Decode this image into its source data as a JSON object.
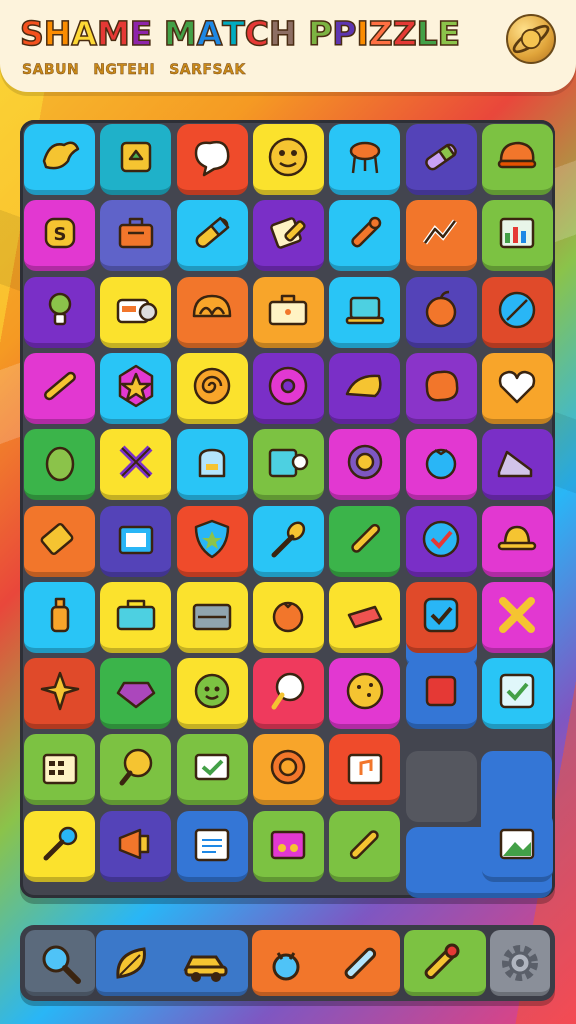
{
  "header": {
    "title_letters": [
      {
        "ch": "S",
        "color": "#f4511e"
      },
      {
        "ch": "H",
        "color": "#fb8c00"
      },
      {
        "ch": "A",
        "color": "#fdd835"
      },
      {
        "ch": "M",
        "color": "#e53935"
      },
      {
        "ch": "E",
        "color": "#8e24aa"
      },
      {
        "ch": " ",
        "color": "#000000"
      },
      {
        "ch": "M",
        "color": "#43a047"
      },
      {
        "ch": "A",
        "color": "#1e88e5"
      },
      {
        "ch": "T",
        "color": "#00acc1"
      },
      {
        "ch": "C",
        "color": "#e53935"
      },
      {
        "ch": "H",
        "color": "#8d6e63"
      },
      {
        "ch": " ",
        "color": "#000000"
      },
      {
        "ch": "P",
        "color": "#7cb342"
      },
      {
        "ch": "P",
        "color": "#5e35b1"
      },
      {
        "ch": "I",
        "color": "#fb8c00"
      },
      {
        "ch": "Z",
        "color": "#ff7043"
      },
      {
        "ch": "Z",
        "color": "#e53935"
      },
      {
        "ch": "L",
        "color": "#43a047"
      },
      {
        "ch": "E",
        "color": "#8bc34a"
      }
    ],
    "subtitle_parts": [
      "SABUN",
      "NGTEHI",
      "SARFSAK"
    ],
    "settings_icon": "planet-icon"
  },
  "board": {
    "rows": [
      [
        {
          "c": "#29c5f6",
          "i": "bird"
        },
        {
          "c": "#1fb1c9",
          "i": "cube"
        },
        {
          "c": "#ef4b2b",
          "i": "heart-bubble"
        },
        {
          "c": "#fbe22d",
          "i": "face"
        },
        {
          "c": "#29c5f6",
          "i": "stool"
        },
        {
          "c": "#5443b8",
          "i": "pencil"
        },
        {
          "c": "#7cc242",
          "i": "helmet"
        }
      ],
      [
        {
          "c": "#e238d1",
          "i": "coin"
        },
        {
          "c": "#5f63c9",
          "i": "briefcase"
        },
        {
          "c": "#29c5f6",
          "i": "marker"
        },
        {
          "c": "#7a2fc7",
          "i": "note-pencil"
        },
        {
          "c": "#29c5f6",
          "i": "wand"
        },
        {
          "c": "#f2762b",
          "i": "chart"
        },
        {
          "c": "#7cc242",
          "i": "bar-chart"
        }
      ],
      [
        {
          "c": "#7a2fc7",
          "i": "bulb"
        },
        {
          "c": "#fbe22d",
          "i": "camera"
        },
        {
          "c": "#f2762b",
          "i": "shell"
        },
        {
          "c": "#f8a52a",
          "i": "case"
        },
        {
          "c": "#29c5f6",
          "i": "laptop"
        },
        {
          "c": "#5443b8",
          "i": "apple"
        },
        {
          "c": "#e04a2a",
          "i": "compass"
        }
      ],
      [
        {
          "c": "#e238d1",
          "i": "pen"
        },
        {
          "c": "#29c5f6",
          "i": "star-gem"
        },
        {
          "c": "#fbe22d",
          "i": "spiral"
        },
        {
          "c": "#7a2fc7",
          "i": "donut"
        },
        {
          "c": "#7a2fc7",
          "i": "cheese"
        },
        {
          "c": "#8a34c9",
          "i": "blob"
        },
        {
          "c": "#f8a52a",
          "i": "heart"
        }
      ],
      [
        {
          "c": "#3bb44a",
          "i": "egg"
        },
        {
          "c": "#fbe22d",
          "i": "cross-tools"
        },
        {
          "c": "#29c5f6",
          "i": "kettle"
        },
        {
          "c": "#7cc242",
          "i": "tag-card"
        },
        {
          "c": "#e238d1",
          "i": "target"
        },
        {
          "c": "#e238d1",
          "i": "berry"
        },
        {
          "c": "#7a2fc7",
          "i": "shoe"
        }
      ],
      [
        {
          "c": "#f2762b",
          "i": "stamp"
        },
        {
          "c": "#5443b8",
          "i": "tv"
        },
        {
          "c": "#ef4b2b",
          "i": "shield"
        },
        {
          "c": "#29c5f6",
          "i": "spoon"
        },
        {
          "c": "#3bb44a",
          "i": "brush"
        },
        {
          "c": "#7a2fc7",
          "i": "check-circle"
        },
        {
          "c": "#e238d1",
          "i": "hat"
        }
      ],
      [
        {
          "c": "#29c5f6",
          "i": "bottle"
        },
        {
          "c": "#fbe22d",
          "i": "toolbox"
        },
        {
          "c": "#fbe22d",
          "i": "basket"
        },
        {
          "c": "#fbe22d",
          "i": "tomato"
        },
        {
          "c": "#fbe22d",
          "i": "eraser"
        },
        {
          "c": "#e04a2a",
          "i": "check-box"
        },
        {
          "c": "#e238d1",
          "i": "cross"
        }
      ],
      [
        {
          "c": "#e04a2a",
          "i": "star"
        },
        {
          "c": "#3bb44a",
          "i": "gem"
        },
        {
          "c": "#fbe22d",
          "i": "gear-face"
        },
        {
          "c": "#ef3a5d",
          "i": "bubble"
        },
        {
          "c": "#e238d1",
          "i": "cookie"
        },
        {
          "c": "#3476d6",
          "i": "square"
        },
        {
          "c": "#29c5f6",
          "i": "check-board"
        }
      ],
      [
        {
          "c": "#7cc242",
          "i": "calc"
        },
        {
          "c": "#7cc242",
          "i": "mirror"
        },
        {
          "c": "#7cc242",
          "i": "check-card"
        },
        {
          "c": "#f8a52a",
          "i": "sun-gear"
        },
        {
          "c": "#ef4b2b",
          "i": "music-card"
        },
        {
          "c": null,
          "i": null
        },
        {
          "c": null,
          "i": null
        }
      ],
      [
        {
          "c": "#fbe22d",
          "i": "mic"
        },
        {
          "c": "#5443b8",
          "i": "megaphone"
        },
        {
          "c": "#3476d6",
          "i": "notepad"
        },
        {
          "c": "#7cc242",
          "i": "radio"
        },
        {
          "c": "#7cc242",
          "i": "syringe"
        },
        {
          "c": null,
          "i": null
        },
        {
          "c": "#3476d6",
          "i": "picture"
        }
      ]
    ]
  },
  "toolbar": {
    "segments": [
      {
        "color": "#5b6a7c"
      },
      {
        "color": "#3b78c9"
      },
      {
        "color": "#f2762b"
      },
      {
        "color": "#7cc242"
      },
      {
        "color": "#8a8f99"
      }
    ],
    "items": [
      {
        "icon": "magnifier-icon"
      },
      {
        "icon": "leaf-icon"
      },
      {
        "icon": "car-icon"
      },
      {
        "icon": "bug-icon"
      },
      {
        "icon": "pencil-icon"
      },
      {
        "icon": "paintbrush-icon"
      },
      {
        "icon": "gear-icon"
      }
    ]
  }
}
